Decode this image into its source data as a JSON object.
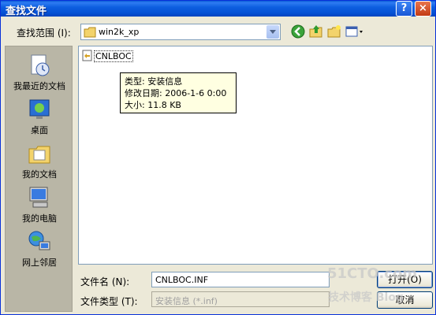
{
  "window": {
    "title": "查找文件",
    "help_label": "?",
    "close_label": "×"
  },
  "lookin": {
    "label": "查找范围 (I):",
    "value": "win2k_xp"
  },
  "places": [
    {
      "label": "我最近的文档",
      "icon": "recent-documents-icon"
    },
    {
      "label": "桌面",
      "icon": "desktop-icon"
    },
    {
      "label": "我的文档",
      "icon": "my-documents-icon"
    },
    {
      "label": "我的电脑",
      "icon": "my-computer-icon"
    },
    {
      "label": "网上邻居",
      "icon": "network-places-icon"
    }
  ],
  "files": [
    {
      "name": "CNLBOC",
      "icon": "setup-info-file-icon"
    }
  ],
  "tooltip": {
    "line1": "类型: 安装信息",
    "line2": "修改日期: 2006-1-6 0:00",
    "line3": "大小: 11.8 KB"
  },
  "filename": {
    "label": "文件名 (N):",
    "value": "CNLBOC.INF"
  },
  "filetype": {
    "label": "文件类型 (T):",
    "value": "安装信息 (*.inf)"
  },
  "buttons": {
    "open": "打开(O)",
    "cancel": "取消"
  },
  "watermark": {
    "line1": "51CTO.com",
    "line2": "技术博客 Blog"
  }
}
